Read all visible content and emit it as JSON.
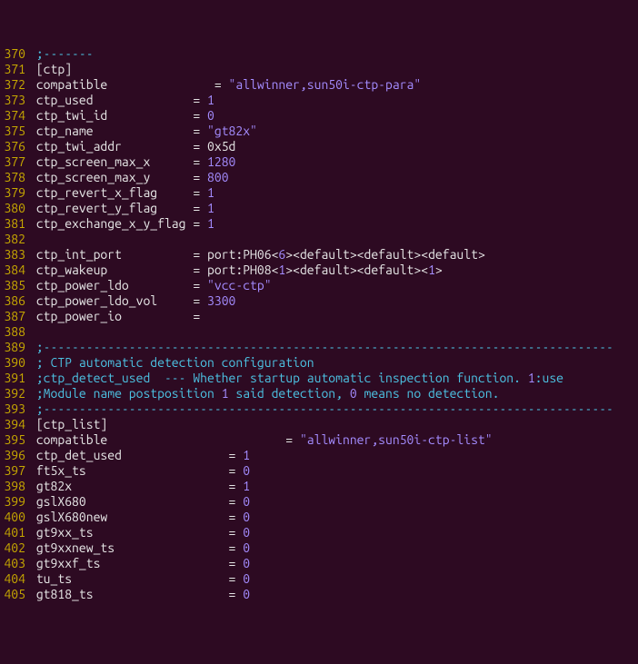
{
  "lines": [
    {
      "num": "370",
      "segs": [
        {
          "cls": "comment",
          "t": ";-------"
        }
      ]
    },
    {
      "num": "371",
      "segs": [
        {
          "cls": "sect",
          "t": "[ctp]"
        }
      ]
    },
    {
      "num": "372",
      "segs": [
        {
          "cls": "kw",
          "t": "compatible               "
        },
        {
          "cls": "op",
          "t": "= "
        },
        {
          "cls": "str",
          "t": "\"allwinner,sun50i-ctp-para\""
        }
      ]
    },
    {
      "num": "373",
      "segs": [
        {
          "cls": "kw",
          "t": "ctp_used              "
        },
        {
          "cls": "op",
          "t": "= "
        },
        {
          "cls": "num",
          "t": "1"
        }
      ]
    },
    {
      "num": "374",
      "segs": [
        {
          "cls": "kw",
          "t": "ctp_twi_id            "
        },
        {
          "cls": "op",
          "t": "= "
        },
        {
          "cls": "num",
          "t": "0"
        }
      ]
    },
    {
      "num": "375",
      "segs": [
        {
          "cls": "kw",
          "t": "ctp_name              "
        },
        {
          "cls": "op",
          "t": "= "
        },
        {
          "cls": "str",
          "t": "\"gt82x\""
        }
      ]
    },
    {
      "num": "376",
      "segs": [
        {
          "cls": "kw",
          "t": "ctp_twi_addr          "
        },
        {
          "cls": "op",
          "t": "= 0x5d"
        }
      ]
    },
    {
      "num": "377",
      "segs": [
        {
          "cls": "kw",
          "t": "ctp_screen_max_x      "
        },
        {
          "cls": "op",
          "t": "= "
        },
        {
          "cls": "num",
          "t": "1280"
        }
      ]
    },
    {
      "num": "378",
      "segs": [
        {
          "cls": "kw",
          "t": "ctp_screen_max_y      "
        },
        {
          "cls": "op",
          "t": "= "
        },
        {
          "cls": "num",
          "t": "800"
        }
      ]
    },
    {
      "num": "379",
      "segs": [
        {
          "cls": "kw",
          "t": "ctp_revert_x_flag     "
        },
        {
          "cls": "op",
          "t": "= "
        },
        {
          "cls": "num",
          "t": "1"
        }
      ]
    },
    {
      "num": "380",
      "segs": [
        {
          "cls": "kw",
          "t": "ctp_revert_y_flag     "
        },
        {
          "cls": "op",
          "t": "= "
        },
        {
          "cls": "num",
          "t": "1"
        }
      ]
    },
    {
      "num": "381",
      "segs": [
        {
          "cls": "kw",
          "t": "ctp_exchange_x_y_flag "
        },
        {
          "cls": "op",
          "t": "= "
        },
        {
          "cls": "num",
          "t": "1"
        }
      ]
    },
    {
      "num": "382",
      "segs": [
        {
          "cls": "txt",
          "t": ""
        }
      ]
    },
    {
      "num": "383",
      "segs": [
        {
          "cls": "kw",
          "t": "ctp_int_port          "
        },
        {
          "cls": "op",
          "t": "= "
        },
        {
          "cls": "txt",
          "t": "port:PH06<"
        },
        {
          "cls": "num",
          "t": "6"
        },
        {
          "cls": "txt",
          "t": "><default><default><default>"
        }
      ]
    },
    {
      "num": "384",
      "segs": [
        {
          "cls": "kw",
          "t": "ctp_wakeup            "
        },
        {
          "cls": "op",
          "t": "= "
        },
        {
          "cls": "txt",
          "t": "port:PH08<"
        },
        {
          "cls": "num",
          "t": "1"
        },
        {
          "cls": "txt",
          "t": "><default><default><"
        },
        {
          "cls": "num",
          "t": "1"
        },
        {
          "cls": "txt",
          "t": ">"
        }
      ]
    },
    {
      "num": "385",
      "segs": [
        {
          "cls": "kw",
          "t": "ctp_power_ldo         "
        },
        {
          "cls": "op",
          "t": "= "
        },
        {
          "cls": "str",
          "t": "\"vcc-ctp\""
        }
      ]
    },
    {
      "num": "386",
      "segs": [
        {
          "cls": "kw",
          "t": "ctp_power_ldo_vol     "
        },
        {
          "cls": "op",
          "t": "= "
        },
        {
          "cls": "num",
          "t": "3300"
        }
      ]
    },
    {
      "num": "387",
      "segs": [
        {
          "cls": "kw",
          "t": "ctp_power_io          "
        },
        {
          "cls": "op",
          "t": "="
        }
      ]
    },
    {
      "num": "388",
      "segs": [
        {
          "cls": "txt",
          "t": ""
        }
      ]
    },
    {
      "num": "389",
      "segs": [
        {
          "cls": "comment",
          "t": ";--------------------------------------------------------------------------------"
        }
      ]
    },
    {
      "num": "390",
      "segs": [
        {
          "cls": "comment",
          "t": "; CTP automatic detection configuration"
        }
      ]
    },
    {
      "num": "391",
      "segs": [
        {
          "cls": "comment",
          "t": ";ctp_detect_used  --- Whether startup automatic inspection function. "
        },
        {
          "cls": "num",
          "t": "1"
        },
        {
          "cls": "comment",
          "t": ":use"
        }
      ]
    },
    {
      "num": "392",
      "segs": [
        {
          "cls": "comment",
          "t": ";Module name postposition "
        },
        {
          "cls": "num",
          "t": "1"
        },
        {
          "cls": "comment",
          "t": " said detection, "
        },
        {
          "cls": "num",
          "t": "0"
        },
        {
          "cls": "comment",
          "t": " means no detection."
        }
      ]
    },
    {
      "num": "393",
      "segs": [
        {
          "cls": "comment",
          "t": ";--------------------------------------------------------------------------------"
        }
      ]
    },
    {
      "num": "394",
      "segs": [
        {
          "cls": "sect",
          "t": "[ctp_list]"
        }
      ]
    },
    {
      "num": "395",
      "segs": [
        {
          "cls": "kw",
          "t": "compatible                         "
        },
        {
          "cls": "op",
          "t": "= "
        },
        {
          "cls": "str",
          "t": "\"allwinner,sun50i-ctp-list\""
        }
      ]
    },
    {
      "num": "396",
      "segs": [
        {
          "cls": "kw",
          "t": "ctp_det_used               "
        },
        {
          "cls": "op",
          "t": "= "
        },
        {
          "cls": "num",
          "t": "1"
        }
      ]
    },
    {
      "num": "397",
      "segs": [
        {
          "cls": "kw",
          "t": "ft5x_ts                    "
        },
        {
          "cls": "op",
          "t": "= "
        },
        {
          "cls": "num",
          "t": "0"
        }
      ]
    },
    {
      "num": "398",
      "segs": [
        {
          "cls": "kw",
          "t": "gt82x                      "
        },
        {
          "cls": "op",
          "t": "= "
        },
        {
          "cls": "num",
          "t": "1"
        }
      ]
    },
    {
      "num": "399",
      "segs": [
        {
          "cls": "kw",
          "t": "gslX680                    "
        },
        {
          "cls": "op",
          "t": "= "
        },
        {
          "cls": "num",
          "t": "0"
        }
      ]
    },
    {
      "num": "400",
      "segs": [
        {
          "cls": "kw",
          "t": "gslX680new                 "
        },
        {
          "cls": "op",
          "t": "= "
        },
        {
          "cls": "num",
          "t": "0"
        }
      ]
    },
    {
      "num": "401",
      "segs": [
        {
          "cls": "kw",
          "t": "gt9xx_ts                   "
        },
        {
          "cls": "op",
          "t": "= "
        },
        {
          "cls": "num",
          "t": "0"
        }
      ]
    },
    {
      "num": "402",
      "segs": [
        {
          "cls": "kw",
          "t": "gt9xxnew_ts                "
        },
        {
          "cls": "op",
          "t": "= "
        },
        {
          "cls": "num",
          "t": "0"
        }
      ]
    },
    {
      "num": "403",
      "segs": [
        {
          "cls": "kw",
          "t": "gt9xxf_ts                  "
        },
        {
          "cls": "op",
          "t": "= "
        },
        {
          "cls": "num",
          "t": "0"
        }
      ]
    },
    {
      "num": "404",
      "segs": [
        {
          "cls": "kw",
          "t": "tu_ts                      "
        },
        {
          "cls": "op",
          "t": "= "
        },
        {
          "cls": "num",
          "t": "0"
        }
      ]
    },
    {
      "num": "405",
      "segs": [
        {
          "cls": "kw",
          "t": "gt818_ts                   "
        },
        {
          "cls": "op",
          "t": "= "
        },
        {
          "cls": "num",
          "t": "0"
        }
      ]
    }
  ]
}
